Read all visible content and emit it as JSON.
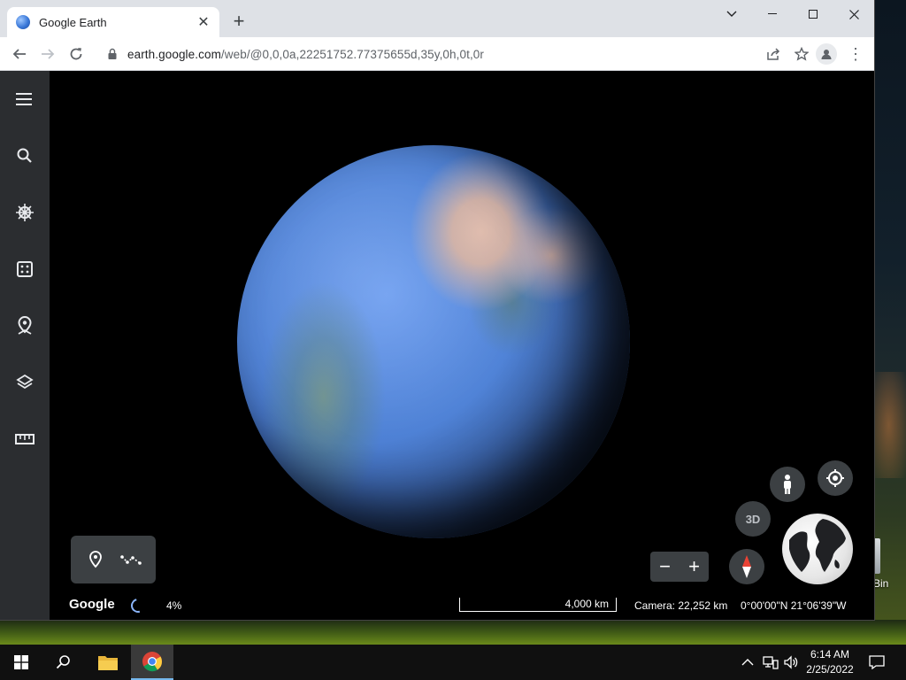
{
  "browser": {
    "tab_title": "Google Earth",
    "url_host": "earth.google.com",
    "url_path": "/web/@0,0,0a,22251752.77375655d,35y,0h,0t,0r"
  },
  "earth": {
    "logo": "Google",
    "loading_percent": "4%",
    "scale_label": "4,000 km",
    "camera": "Camera: 22,252 km",
    "coordinates": "0°00'00\"N 21°06'39\"W",
    "btn_3d": "3D"
  },
  "desktop": {
    "recycle_bin_label": "Bin"
  },
  "taskbar": {
    "time": "6:14 AM",
    "date": "2/25/2022"
  },
  "colors": {
    "accent": "#8ab4f8",
    "sidebar": "#2b2d30",
    "control_bg": "#3c4043",
    "compass_red": "#ea4335"
  }
}
